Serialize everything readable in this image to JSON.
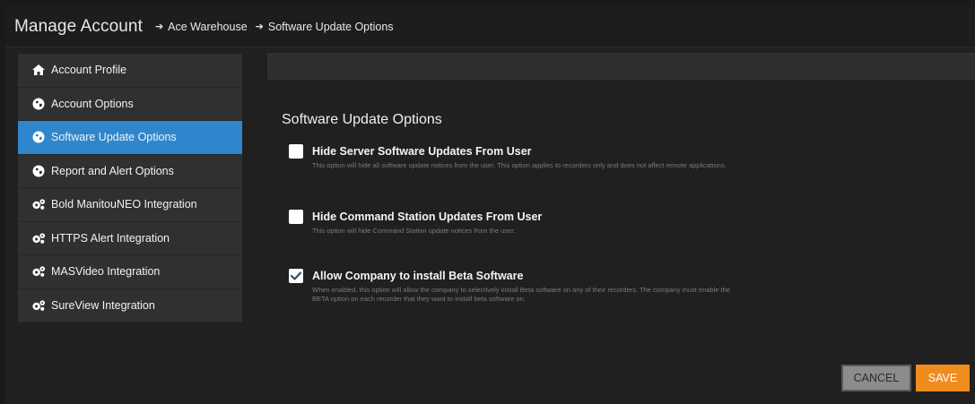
{
  "header": {
    "title": "Manage Account",
    "breadcrumbs": [
      "Ace Warehouse",
      "Software Update Options"
    ]
  },
  "sidebar": {
    "items": [
      {
        "label": "Account Profile",
        "icon": "home-icon",
        "active": false
      },
      {
        "label": "Account Options",
        "icon": "globe-icon",
        "active": false
      },
      {
        "label": "Software Update Options",
        "icon": "globe-icon",
        "active": true
      },
      {
        "label": "Report and Alert Options",
        "icon": "globe-icon",
        "active": false
      },
      {
        "label": "Bold ManitouNEO Integration",
        "icon": "gears-icon",
        "active": false
      },
      {
        "label": "HTTPS Alert Integration",
        "icon": "gears-icon",
        "active": false
      },
      {
        "label": "MASVideo Integration",
        "icon": "gears-icon",
        "active": false
      },
      {
        "label": "SureView Integration",
        "icon": "gears-icon",
        "active": false
      }
    ]
  },
  "main": {
    "section_title": "Software Update Options",
    "options": [
      {
        "label": "Hide Server Software Updates From User",
        "checked": false,
        "desc": "This option will hide all software update notices from the user. This option applies to recorders only and does not affect remote applications."
      },
      {
        "label": "Hide Command Station Updates From User",
        "checked": false,
        "desc": "This option will hide Command Station update notices from the user."
      },
      {
        "label": "Allow Company to install Beta Software",
        "checked": true,
        "desc": "When enabled, this option will allow the company to selectively install Beta software on any of their recorders. The company must enable the BETA option on each recorder that they want to install beta software on."
      }
    ]
  },
  "actions": {
    "cancel_label": "CANCEL",
    "save_label": "SAVE"
  },
  "colors": {
    "accent": "#2f86cc",
    "save": "#f08c1e",
    "cancel": "#8c8c8c"
  }
}
